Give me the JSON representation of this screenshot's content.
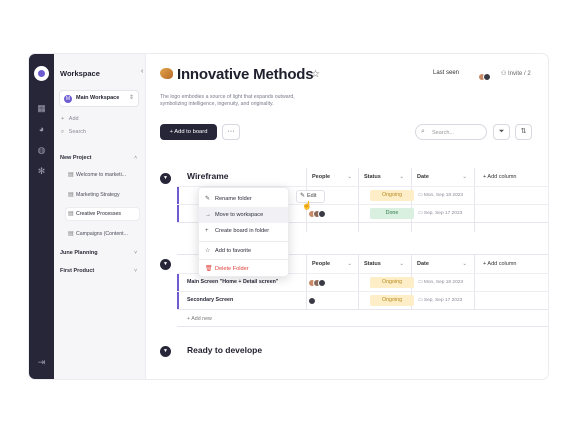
{
  "sidebar": {
    "title": "Workspace",
    "workspace": {
      "initial": "M",
      "label": "Main Workspace"
    },
    "add_label": "Add",
    "search_label": "Search",
    "groups": [
      {
        "label": "New Project",
        "items": [
          "Welcome to marketi...",
          "Marketing Strategy",
          "Creative Processes",
          "Campaigns (Content..."
        ]
      },
      {
        "label": "June Planning"
      },
      {
        "label": "First Product"
      }
    ]
  },
  "header": {
    "title": "Innovative Methods",
    "last_seen": "Last seen",
    "invite": "Invite / 2",
    "description": "The logo embodies a source of light that expands outward, symbolizing intelligence, ingenuity, and originality."
  },
  "toolbar": {
    "add_board": "+ Add to board",
    "more": "···",
    "search_placeholder": "Search..."
  },
  "columns": {
    "people": "People",
    "status": "Status",
    "date": "Date",
    "add_column": "+ Add column"
  },
  "sections": [
    {
      "title": "Wireframe",
      "rows": [
        {
          "status": "Ongoing",
          "date": "Mon, Sep 18 2023"
        },
        {
          "status": "Done",
          "date": "Sep, Sep 17 2023"
        }
      ]
    },
    {
      "title": "",
      "rows": [
        {
          "name": "Main Screen \"Home + Detail screen\"",
          "status": "Ongoing",
          "date": "Mon, Sep 18 2023"
        },
        {
          "name": "Secondary Screen",
          "status": "Ongoing",
          "date": "Sep, Sep 17 2023"
        }
      ],
      "add_new": "+ Add new"
    },
    {
      "title": "Ready to develope"
    }
  ],
  "context_menu": {
    "items": [
      "Rename folder",
      "Move to workspace",
      "Create board in folder",
      "Add to favorite",
      "Delete Folder"
    ],
    "edit": "Edit"
  },
  "colors": {
    "dark": "#262638",
    "accent": "#6d5bd0",
    "ongoing": "#fdeec8",
    "done": "#d9efe0",
    "danger": "#e0403a"
  }
}
